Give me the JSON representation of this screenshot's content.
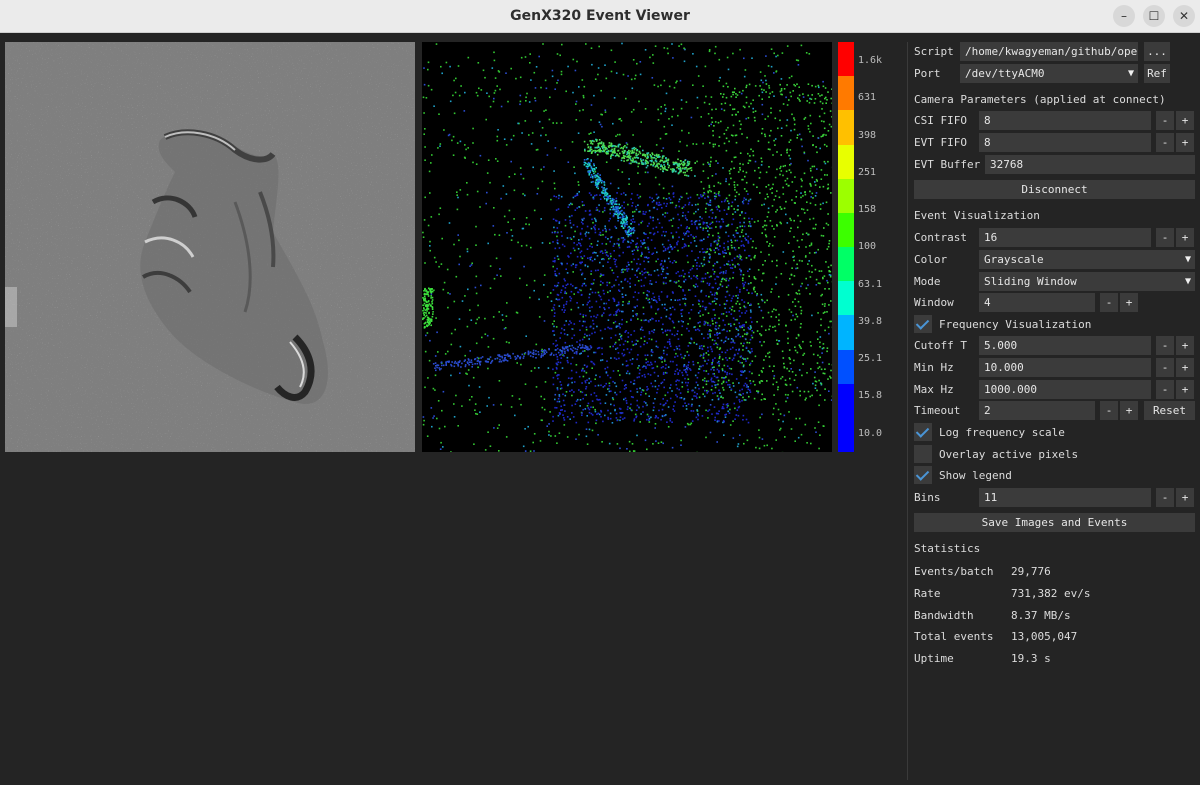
{
  "window": {
    "title": "GenX320 Event Viewer",
    "minimize": "–",
    "maximize": "☐",
    "close": "✕"
  },
  "colorbar": {
    "labels": [
      "1.6k",
      "631",
      "398",
      "251",
      "158",
      "100",
      "63.1",
      "39.8",
      "25.1",
      "15.8",
      "10.0"
    ],
    "colors": [
      "#ff0000",
      "#ff7a00",
      "#ffc000",
      "#e8ff00",
      "#9cff00",
      "#3cff00",
      "#00ff66",
      "#00ffd0",
      "#00b4ff",
      "#0050ff",
      "#0000ff",
      "#0000ff"
    ]
  },
  "panel": {
    "script": {
      "label": "Script",
      "value": "/home/kwagyeman/github/openmv-projects/",
      "browse": "..."
    },
    "port": {
      "label": "Port",
      "value": "/dev/ttyACM0",
      "refresh": "Ref"
    },
    "camera_params": {
      "heading": "Camera Parameters  (applied at connect)"
    },
    "csi_fifo": {
      "label": "CSI FIFO",
      "value": "8"
    },
    "evt_fifo": {
      "label": "EVT FIFO",
      "value": "8"
    },
    "evt_buffer": {
      "label": "EVT Buffer",
      "value": "32768"
    },
    "disconnect": "Disconnect",
    "event_vis": {
      "heading": "Event Visualization"
    },
    "contrast": {
      "label": "Contrast",
      "value": "16"
    },
    "color": {
      "label": "Color",
      "value": "Grayscale"
    },
    "mode": {
      "label": "Mode",
      "value": "Sliding Window"
    },
    "window": {
      "label": "Window",
      "value": "4"
    },
    "freq_vis": {
      "label": "Frequency Visualization",
      "checked": true
    },
    "cutoff": {
      "label": "Cutoff T",
      "value": "5.000"
    },
    "min_hz": {
      "label": "Min Hz",
      "value": "10.000"
    },
    "max_hz": {
      "label": "Max Hz",
      "value": "1000.000"
    },
    "timeout": {
      "label": "Timeout",
      "value": "2",
      "reset": "Reset"
    },
    "log_scale": {
      "label": "Log frequency scale",
      "checked": true
    },
    "overlay": {
      "label": "Overlay active pixels",
      "checked": false
    },
    "legend": {
      "label": "Show legend",
      "checked": true
    },
    "bins": {
      "label": "Bins",
      "value": "11"
    },
    "save": "Save Images and Events",
    "minus": "-",
    "plus": "+",
    "dropdown_arrow": "▼",
    "stats": {
      "heading": "Statistics",
      "rows": [
        {
          "label": "Events/batch",
          "value": "29,776"
        },
        {
          "label": "Rate",
          "value": "731,382 ev/s"
        },
        {
          "label": "Bandwidth",
          "value": "8.37 MB/s"
        },
        {
          "label": "Total events",
          "value": "13,005,047"
        },
        {
          "label": "Uptime",
          "value": "19.3 s"
        }
      ]
    }
  }
}
